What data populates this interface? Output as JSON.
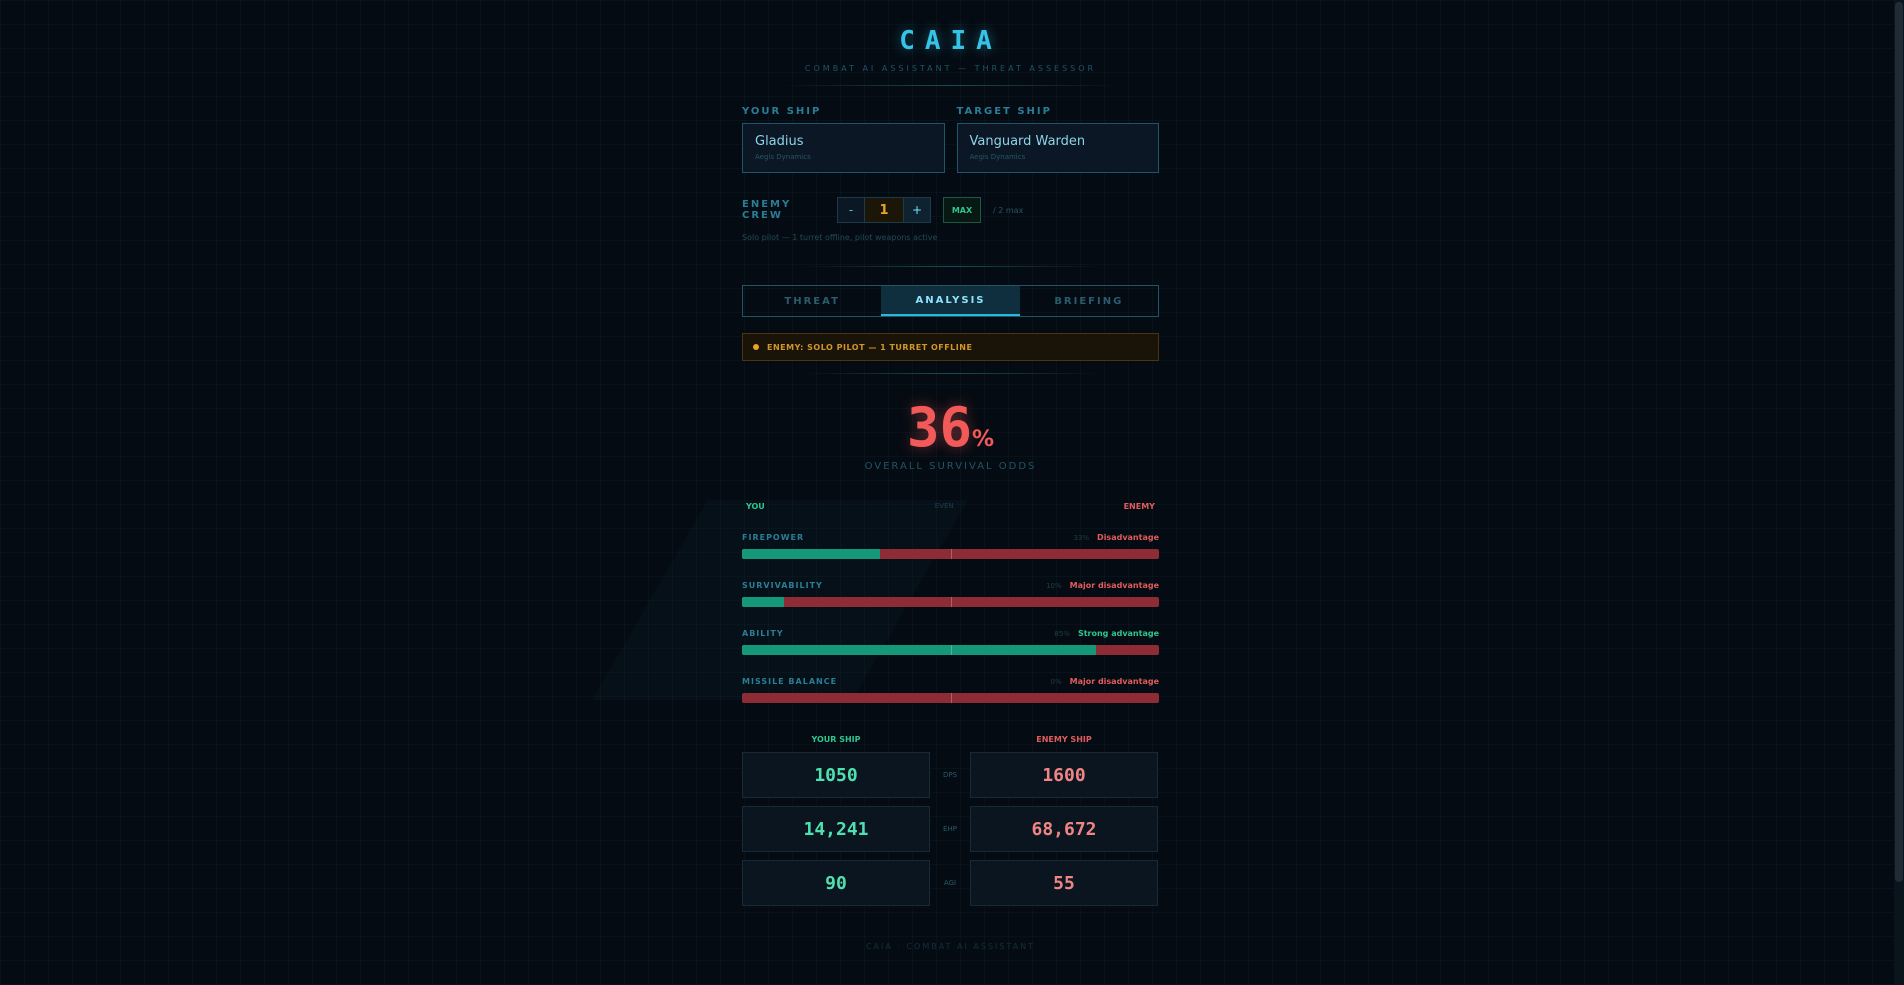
{
  "app": {
    "title": "CAIA",
    "subtitle": "COMBAT AI ASSISTANT — THREAT ASSESSOR"
  },
  "your_ship": {
    "label": "YOUR SHIP",
    "name": "Gladius",
    "maker": "Aegis Dynamics"
  },
  "target_ship": {
    "label": "TARGET SHIP",
    "name": "Vanguard Warden",
    "maker": "Aegis Dynamics"
  },
  "crew": {
    "label": "ENEMY CREW",
    "minus": "-",
    "value": "1",
    "plus": "+",
    "max_label": "MAX",
    "max_note": "/ 2 max",
    "note": "Solo pilot — 1 turret offline, pilot weapons active"
  },
  "tabs": [
    {
      "label": "THREAT"
    },
    {
      "label": "ANALYSIS"
    },
    {
      "label": "BRIEFING"
    }
  ],
  "active_tab": "ANALYSIS",
  "alert": {
    "text": "ENEMY: SOLO PILOT — 1 TURRET OFFLINE"
  },
  "odds": {
    "value": "36",
    "unit": "%",
    "label": "OVERALL SURVIVAL ODDS"
  },
  "scale": {
    "you": "YOU",
    "even": "EVEN",
    "enemy": "ENEMY"
  },
  "metrics": [
    {
      "name": "FIREPOWER",
      "pct": "33%",
      "verdict": "Disadvantage",
      "share": 0.33,
      "tone": "bad"
    },
    {
      "name": "SURVIVABILITY",
      "pct": "10%",
      "verdict": "Major disadvantage",
      "share": 0.1,
      "tone": "bad"
    },
    {
      "name": "ABILITY",
      "pct": "85%",
      "verdict": "Strong advantage",
      "share": 0.85,
      "tone": "good"
    },
    {
      "name": "MISSILE BALANCE",
      "pct": "0%",
      "verdict": "Major disadvantage",
      "share": 0.0,
      "tone": "bad"
    }
  ],
  "compare": {
    "you_header": "YOUR SHIP",
    "enemy_header": "ENEMY SHIP",
    "rows": [
      {
        "label": "DPS",
        "you": "1050",
        "enemy": "1600"
      },
      {
        "label": "EHP",
        "you": "14,241",
        "enemy": "68,672"
      },
      {
        "label": "AGI",
        "you": "90",
        "enemy": "55"
      }
    ]
  },
  "footer": "CAIA · COMBAT AI ASSISTANT",
  "colors": {
    "accent": "#35c4e6",
    "good": "#2ec58e",
    "bad": "#e05c5c",
    "warning": "#e5a42a",
    "background": "#050b12"
  }
}
